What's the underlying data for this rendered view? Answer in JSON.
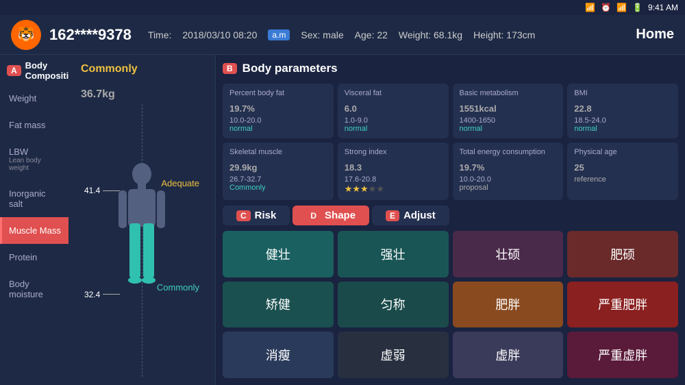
{
  "statusBar": {
    "time": "9:41 AM"
  },
  "header": {
    "userPhone": "162****9378",
    "timeLabel": "Time:",
    "timeValue": "2018/03/10 08:20",
    "amLabel": "a.m",
    "sexLabel": "Sex: male",
    "ageLabel": "Age: 22",
    "weightLabel": "Weight: 68.1kg",
    "heightLabel": "Height: 173cm",
    "homeLabel": "Home"
  },
  "sidebar": {
    "sectionBadge": "A",
    "sectionTitle": "Body Composition",
    "items": [
      {
        "label": "Weight",
        "sub": "",
        "active": false
      },
      {
        "label": "Fat mass",
        "sub": "",
        "active": false
      },
      {
        "label": "LBW",
        "sub": "Lean body weight",
        "active": false
      },
      {
        "label": "Inorganic salt",
        "sub": "",
        "active": false
      },
      {
        "label": "Muscle Mass",
        "sub": "",
        "active": true
      },
      {
        "label": "Protein",
        "sub": "",
        "active": false
      },
      {
        "label": "Body moisture",
        "sub": "",
        "active": false
      }
    ]
  },
  "bodyPanel": {
    "statusLabel": "Commonly",
    "value": "36.7",
    "unit": "kg",
    "indicator1Value": "41.4",
    "indicator1Label": "Adequate",
    "indicator2Value": "32.4",
    "indicator2Label": "Commonly"
  },
  "bodyParams": {
    "sectionBadge": "B",
    "sectionTitle": "Body parameters",
    "cards": [
      {
        "label": "Percent body fat",
        "value": "19.7",
        "unit": "%",
        "range": "10.0-20.0",
        "status": "normal",
        "statusClass": ""
      },
      {
        "label": "Visceral fat",
        "value": "6.0",
        "unit": "",
        "range": "1.0-9.0",
        "status": "normal",
        "statusClass": ""
      },
      {
        "label": "Basic metabolism",
        "value": "1551",
        "unit": "kcal",
        "range": "1400-1650",
        "status": "normal",
        "statusClass": ""
      },
      {
        "label": "BMI",
        "value": "22.8",
        "unit": "",
        "range": "18.5-24.0",
        "status": "normal",
        "statusClass": ""
      },
      {
        "label": "Skeletal muscle",
        "value": "29.9",
        "unit": "kg",
        "range": "26.7-32.7",
        "status": "Commonly",
        "statusClass": "commonly",
        "stars": 3
      },
      {
        "label": "Strong index",
        "value": "18.3",
        "unit": "",
        "range": "17.6-20.8",
        "status": "",
        "statusClass": "",
        "stars": 3
      },
      {
        "label": "Total energy consumption",
        "value": "19.7",
        "unit": "%",
        "range": "10.0-20.0",
        "status": "proposal",
        "statusClass": "proposal"
      },
      {
        "label": "Physical age",
        "value": "25",
        "unit": "",
        "range": "",
        "status": "reference",
        "statusClass": "reference"
      }
    ]
  },
  "tabs": {
    "items": [
      {
        "badge": "C",
        "label": "Risk",
        "active": false
      },
      {
        "badge": "D",
        "label": "Shape",
        "active": true
      },
      {
        "badge": "E",
        "label": "Adjust",
        "active": false
      }
    ]
  },
  "shapeGrid": {
    "cells": [
      {
        "text": "健壮",
        "colorClass": "cell-teal"
      },
      {
        "text": "强壮",
        "colorClass": "cell-teal2"
      },
      {
        "text": "壮硕",
        "colorClass": "cell-purple"
      },
      {
        "text": "肥硕",
        "colorClass": "cell-red"
      },
      {
        "text": "矫健",
        "colorClass": "cell-teal3"
      },
      {
        "text": "匀称",
        "colorClass": "cell-teal4"
      },
      {
        "text": "肥胖",
        "colorClass": "cell-orange"
      },
      {
        "text": "严重肥胖",
        "colorClass": "cell-darkred"
      },
      {
        "text": "消瘦",
        "colorClass": "cell-slate"
      },
      {
        "text": "虚弱",
        "colorClass": "cell-dark"
      },
      {
        "text": "虚胖",
        "colorClass": "cell-gray"
      },
      {
        "text": "严重虚胖",
        "colorClass": "cell-darkpurple"
      }
    ]
  }
}
